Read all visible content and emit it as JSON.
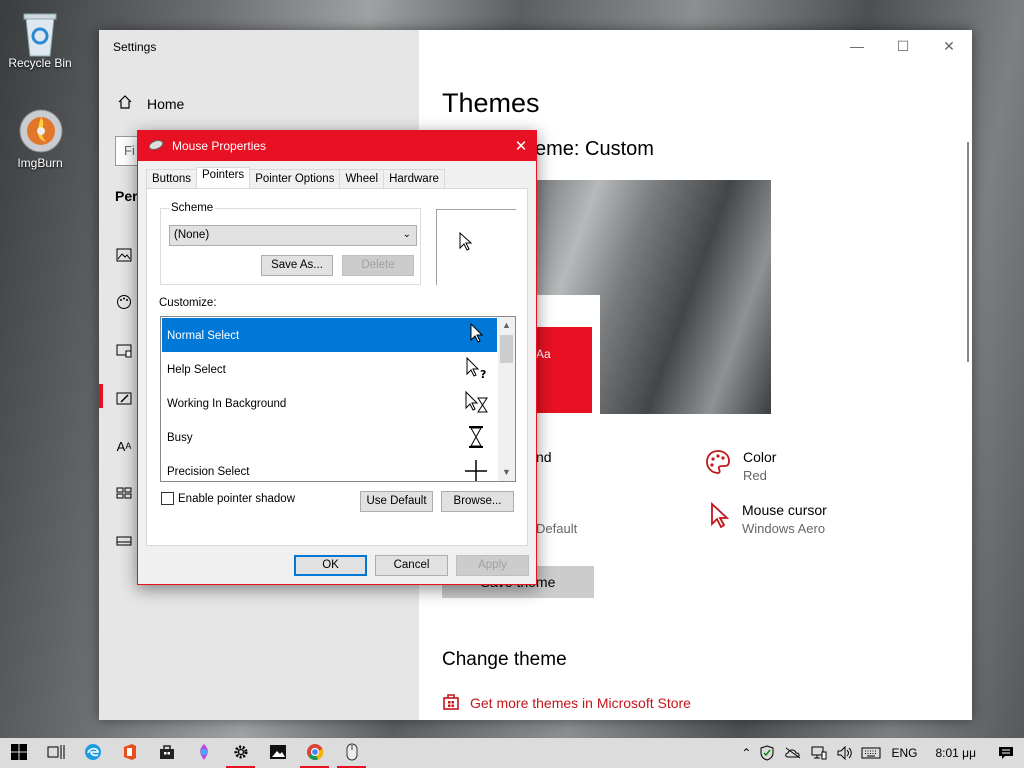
{
  "desktop": {
    "icons": [
      {
        "label": "Recycle Bin",
        "icon": "recycle-bin-icon"
      },
      {
        "label": "ImgBurn",
        "icon": "imgburn-icon"
      }
    ]
  },
  "settings": {
    "title": "Settings",
    "nav": {
      "home_label": "Home",
      "search_placeholder": "Fi",
      "section_title_partial": "Pers",
      "items": [
        {
          "icon": "background-icon"
        },
        {
          "icon": "colors-icon"
        },
        {
          "icon": "lock-screen-icon"
        },
        {
          "icon": "themes-icon",
          "active": true
        },
        {
          "icon": "fonts-icon"
        },
        {
          "icon": "start-icon"
        },
        {
          "icon": "taskbar-icon"
        }
      ]
    },
    "content": {
      "heading": "Themes",
      "current_theme_partial": "eme: Custom",
      "preview_tile_text": "Aa",
      "props": {
        "background_partial": "nd",
        "sounds_partial": "Default",
        "color_label": "Color",
        "color_value": "Red",
        "cursor_label": "Mouse cursor",
        "cursor_value": "Windows Aero"
      },
      "save_theme_label": "Save theme",
      "change_theme_heading": "Change theme",
      "store_link": "Get more themes in Microsoft Store"
    }
  },
  "mouse_dialog": {
    "title": "Mouse Properties",
    "tabs": [
      "Buttons",
      "Pointers",
      "Pointer Options",
      "Wheel",
      "Hardware"
    ],
    "active_tab": "Pointers",
    "scheme_label": "Scheme",
    "scheme_value": "(None)",
    "save_as_label": "Save As...",
    "delete_label": "Delete",
    "customize_label": "Customize:",
    "pointers": [
      {
        "name": "Normal Select",
        "selected": true,
        "icon": "arrow-cursor-icon"
      },
      {
        "name": "Help Select",
        "selected": false,
        "icon": "help-cursor-icon"
      },
      {
        "name": "Working In Background",
        "selected": false,
        "icon": "working-cursor-icon"
      },
      {
        "name": "Busy",
        "selected": false,
        "icon": "hourglass-cursor-icon"
      },
      {
        "name": "Precision Select",
        "selected": false,
        "icon": "crosshair-cursor-icon"
      }
    ],
    "shadow_label": "Enable pointer shadow",
    "shadow_checked": false,
    "use_default_label": "Use Default",
    "browse_label": "Browse...",
    "ok_label": "OK",
    "cancel_label": "Cancel",
    "apply_label": "Apply"
  },
  "taskbar": {
    "apps": [
      "start",
      "task-view",
      "edge",
      "office",
      "store",
      "paint",
      "settings",
      "photos",
      "chrome",
      "mouse"
    ],
    "tray": {
      "language": "ENG",
      "time": "8:01 μμ"
    }
  },
  "colors": {
    "accent": "#e81123",
    "selection": "#0078d7"
  }
}
